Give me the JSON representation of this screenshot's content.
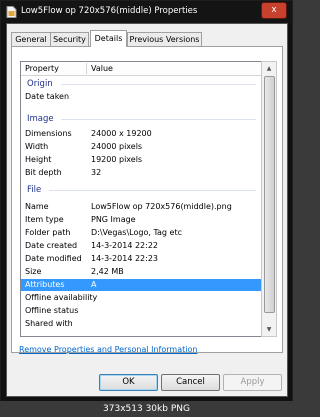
{
  "window": {
    "title": "Low5Flow op 720x576(middle) Properties",
    "close_glyph": "x"
  },
  "tabs": [
    {
      "label": "General"
    },
    {
      "label": "Security"
    },
    {
      "label": "Details"
    },
    {
      "label": "Previous Versions"
    }
  ],
  "columns": {
    "property": "Property",
    "value": "Value"
  },
  "groups": {
    "origin": "Origin",
    "image": "Image",
    "file": "File"
  },
  "origin_rows": [
    {
      "property": "Date taken",
      "value": ""
    }
  ],
  "image_rows": [
    {
      "property": "Dimensions",
      "value": "24000 x 19200"
    },
    {
      "property": "Width",
      "value": "24000 pixels"
    },
    {
      "property": "Height",
      "value": "19200 pixels"
    },
    {
      "property": "Bit depth",
      "value": "32"
    }
  ],
  "file_rows": [
    {
      "property": "Name",
      "value": "Low5Flow op 720x576(middle).png"
    },
    {
      "property": "Item type",
      "value": "PNG Image"
    },
    {
      "property": "Folder path",
      "value": "D:\\Vegas\\Logo, Tag etc"
    },
    {
      "property": "Date created",
      "value": "14-3-2014 22:22"
    },
    {
      "property": "Date modified",
      "value": "14-3-2014 22:23"
    },
    {
      "property": "Size",
      "value": "2,42 MB"
    },
    {
      "property": "Attributes",
      "value": "A"
    },
    {
      "property": "Offline availability",
      "value": ""
    },
    {
      "property": "Offline status",
      "value": ""
    },
    {
      "property": "Shared with",
      "value": ""
    }
  ],
  "link": "Remove Properties and Personal Information",
  "buttons": {
    "ok": "OK",
    "cancel": "Cancel",
    "apply": "Apply"
  },
  "caption": "373x513 30kb PNG",
  "colors": {
    "selection": "#3399ff",
    "group_text": "#1e3287",
    "link": "#0066cc",
    "close": "#c8402e"
  }
}
